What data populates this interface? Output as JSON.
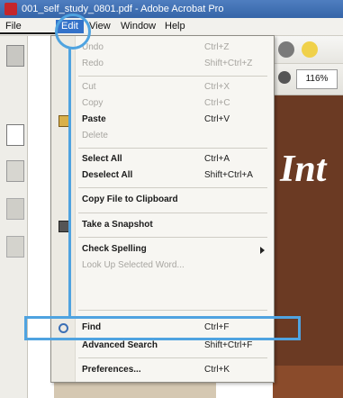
{
  "window": {
    "title": "001_self_study_0801.pdf - Adobe Acrobat Pro"
  },
  "menubar": {
    "items": [
      "File",
      "Edit",
      "View",
      "Window",
      "Help"
    ]
  },
  "toolbar": {
    "zoom": "116%"
  },
  "document": {
    "visible_text": "Int"
  },
  "edit_menu": {
    "items": [
      {
        "label": "Undo",
        "shortcut": "Ctrl+Z"
      },
      {
        "label": "Redo",
        "shortcut": "Shift+Ctrl+Z"
      },
      {
        "label": "Cut",
        "shortcut": "Ctrl+X"
      },
      {
        "label": "Copy",
        "shortcut": "Ctrl+C"
      },
      {
        "label": "Paste",
        "shortcut": "Ctrl+V"
      },
      {
        "label": "Delete",
        "shortcut": ""
      },
      {
        "label": "Select All",
        "shortcut": "Ctrl+A"
      },
      {
        "label": "Deselect All",
        "shortcut": "Shift+Ctrl+A"
      },
      {
        "label": "Copy File to Clipboard",
        "shortcut": ""
      },
      {
        "label": "Take a Snapshot",
        "shortcut": ""
      },
      {
        "label": "Check Spelling",
        "shortcut": ""
      },
      {
        "label": "Look Up Selected Word...",
        "shortcut": ""
      },
      {
        "label": "Find",
        "shortcut": "Ctrl+F"
      },
      {
        "label": "Advanced Search",
        "shortcut": "Shift+Ctrl+F"
      },
      {
        "label": "Preferences...",
        "shortcut": "Ctrl+K"
      }
    ]
  },
  "colors": {
    "highlight": "#4fa3e0",
    "menu_selected": "#3472c9",
    "document_bg": "#6b3a23"
  },
  "icons": [
    "acrobat-app-icon",
    "print-icon",
    "gear-icon",
    "comment-icon",
    "pages-icon",
    "bookmarks-icon",
    "attachments-icon",
    "signatures-icon",
    "paste-icon",
    "snapshot-icon",
    "find-icon"
  ]
}
